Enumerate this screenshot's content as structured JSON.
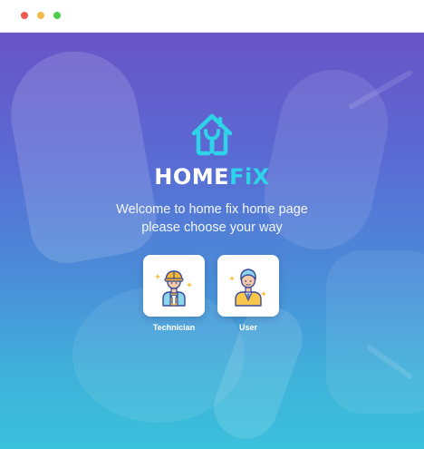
{
  "window": {
    "controls": [
      "close-dot",
      "minimize-dot",
      "maximize-dot"
    ]
  },
  "brand": {
    "logo_icon": "house-wrench-icon",
    "name_part1": "HOME",
    "name_part2": "FiX"
  },
  "welcome": {
    "line1": "Welcome to home fix home page",
    "line2": "please choose your way"
  },
  "options": [
    {
      "label": "Technician",
      "icon": "technician-icon"
    },
    {
      "label": "User",
      "icon": "user-icon"
    }
  ],
  "colors": {
    "accent": "#2fd3e8",
    "gradient_top": "#6a54c7",
    "gradient_bottom": "#3bc1dc"
  }
}
